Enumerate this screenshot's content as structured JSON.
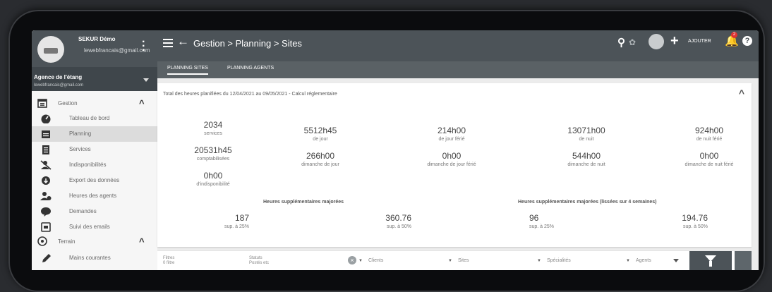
{
  "user": {
    "name": "SEKUR Démo",
    "email": "lewebfrancais@gmail.com"
  },
  "agency": {
    "name": "Agence de l'étang",
    "email": "lewebfrancais@gmail.com"
  },
  "sidebar": {
    "gestion": {
      "label": "Gestion",
      "icon": "calendar-icon"
    },
    "items": [
      {
        "label": "Tableau de bord",
        "icon": "speedometer-icon"
      },
      {
        "label": "Planning",
        "icon": "calendar-icon"
      },
      {
        "label": "Services",
        "icon": "clipboard-icon"
      },
      {
        "label": "Indisponibilités",
        "icon": "person-off-icon"
      },
      {
        "label": "Export des données",
        "icon": "cloud-download-icon"
      },
      {
        "label": "Heures des agents",
        "icon": "person-clock-icon"
      },
      {
        "label": "Demandes",
        "icon": "chat-icon"
      },
      {
        "label": "Suivi des emails",
        "icon": "email-tracking-icon"
      }
    ],
    "terrain": {
      "label": "Terrain",
      "icon": "terrain-icon"
    },
    "terrain_items": [
      {
        "label": "Mains courantes",
        "icon": "pen-icon"
      }
    ]
  },
  "topbar": {
    "breadcrumb": "Gestion > Planning > Sites",
    "add_label": "AJOUTER",
    "notification_count": "2"
  },
  "tabs": [
    {
      "label": "PLANNING SITES",
      "active": true
    },
    {
      "label": "PLANNING AGENTS",
      "active": false
    }
  ],
  "summary": {
    "title": "Total des heures planifiées du 12/04/2021 au 09/05/2021 - Calcul réglementaire",
    "services_value": "2034",
    "services_label": "services",
    "counted_value": "20531h45",
    "counted_label": "comptabilisées",
    "unavail_value": "0h00",
    "unavail_label": "d'indisponibilité",
    "day_value": "5512h45",
    "day_label": "de jour",
    "sunday_day_value": "266h00",
    "sunday_day_label": "dimanche de jour",
    "holiday_day_value": "214h00",
    "holiday_day_label": "de jour férié",
    "sunday_holiday_day_value": "0h00",
    "sunday_holiday_day_label": "dimanche de jour férié",
    "night_value": "13071h00",
    "night_label": "de nuit",
    "sunday_night_value": "544h00",
    "sunday_night_label": "dimanche de nuit",
    "holiday_night_value": "924h00",
    "holiday_night_label": "de nuit férié",
    "sunday_holiday_night_value": "0h00",
    "sunday_holiday_night_label": "dimanche de nuit férié",
    "overtime_heading": "Heures supplémentaires majorées",
    "overtime_25_value": "187",
    "overtime_25_label": "sup. à 25%",
    "overtime_50_value": "360.76",
    "overtime_50_label": "sup. à 50%",
    "smoothed_heading": "Heures supplémentaires majorées (lissées sur 4 semaines)",
    "smoothed_25_value": "96",
    "smoothed_25_label": "sup. à 25%",
    "smoothed_50_value": "194.76",
    "smoothed_50_label": "sup. à 50%"
  },
  "filters": {
    "filters_label": "Filtres",
    "filters_sub": "0 filtre",
    "status_label": "Statuts",
    "status_sub": "Postés etc",
    "clients": "Clients",
    "sites": "Sites",
    "specialties": "Spécialités",
    "agents": "Agents"
  }
}
